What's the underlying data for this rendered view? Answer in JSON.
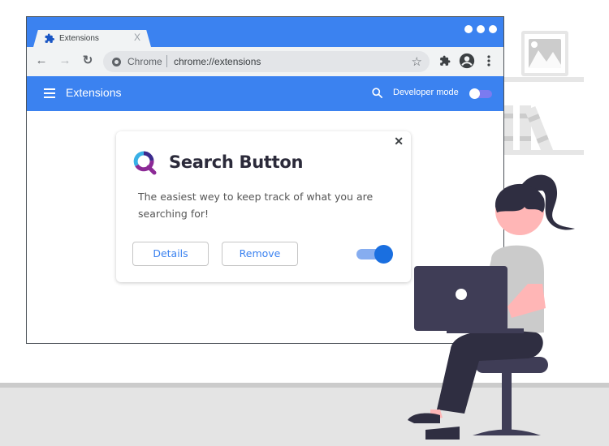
{
  "browser": {
    "tab": {
      "title": "Extensions",
      "icon": "puzzle-icon",
      "close_label": "X"
    },
    "window_controls": [
      "dot",
      "dot",
      "dot"
    ],
    "toolbar": {
      "back_icon": "←",
      "forward_icon": "→",
      "reload_icon": "↻",
      "site_label": "Chrome",
      "url": "chrome://extensions",
      "bookmark_icon": "☆"
    }
  },
  "appbar": {
    "title": "Extensions",
    "developer_mode_label": "Developer mode",
    "developer_mode_on": false
  },
  "extension_card": {
    "name": "Search Button",
    "description": "The easiest wey to keep track of what you are searching for!",
    "close_label": "✕",
    "details_label": "Details",
    "remove_label": "Remove",
    "enabled": true
  },
  "colors": {
    "brand_blue": "#3b82f0",
    "toggle_on": "#1a6fe0",
    "logo_purple": "#8c2a96",
    "logo_cyan": "#39b0e6",
    "logo_navy": "#3c2a8e"
  }
}
